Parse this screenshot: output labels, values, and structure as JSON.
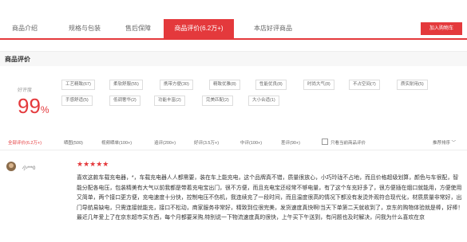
{
  "tabs": [
    {
      "label": "商品介绍",
      "active": false
    },
    {
      "label": "规格与包装",
      "active": false
    },
    {
      "label": "售后保障",
      "active": false
    },
    {
      "label": "商品评价(6.2万+)",
      "active": true
    },
    {
      "label": "本店好评商品",
      "active": false
    }
  ],
  "cart_button": "加入购物车",
  "section_title": "商品评价",
  "rating": {
    "label": "好评度",
    "value": "99",
    "unit": "%"
  },
  "tags": [
    "工艺精致(67)",
    "柔软舒服(55)",
    "携带方便(30)",
    "精致优雅(8)",
    "性能优良(8)",
    "时尚大气(8)",
    "不占空间(7)",
    "质实耐用(5)",
    "手感舒适(5)",
    "低调奢华(2)",
    "功能丰富(2)",
    "完美匹配(2)",
    "大小合适(1)"
  ],
  "filters": [
    {
      "label": "全部评价(6.2万+)",
      "active": true
    },
    {
      "label": "晒图(500)",
      "active": false
    },
    {
      "label": "视频晒单(100+)",
      "active": false
    },
    {
      "label": "追评(200+)",
      "active": false
    },
    {
      "label": "好评(3.5万+)",
      "active": false
    },
    {
      "label": "中评(100+)",
      "active": false
    },
    {
      "label": "差评(90+)",
      "active": false
    }
  ],
  "only_current_label": "只看当前商品评价",
  "sort_label": "推荐排序",
  "review": {
    "user": "小***0",
    "stars": "★★★★★",
    "text": "喜欢这款车载充电器，*，车载充电器人人都需要，装在车上能充电，这个品牌真不错，质量很放心，小巧玲珑不占地，而且价格超级划算，颜色与车很配，智能分配各电压，包装精美有大气以前我都是带着充电宝出门，很不方便，而且充电宝还经常不够电量，有了这个车充好多了，很方便插在烟口就能用，方便使用又简单，两个接口更方便，充电速度十分快，控制电压不伤机，我连续充了一段时间，而且温度很高的情况下都没有发烫外观符合现代化，材质质量非常好，出门导航易缺电，只需连接就能充，接口不松动，商家服务非常好，精致到位很完美，发货速度真快啊!当天下单第二天就收到了，京东的购物体验就是棒，好棒！最近几年爱上了在京东超市买东西，每个月都要采购,特别说一下物流速度真的很快，上午买下午送到，有问题也及时解决，问我为什么喜欢在京"
  }
}
